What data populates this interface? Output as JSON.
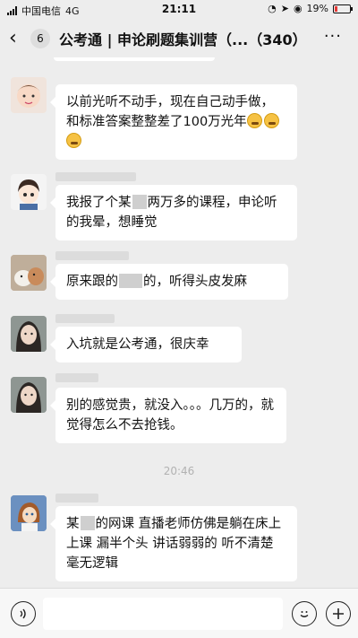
{
  "status_bar": {
    "carrier": "中国电信",
    "network": "4G",
    "time": "21:11",
    "battery_percent": "19%",
    "battery_level": 0.19
  },
  "header": {
    "back_count": "6",
    "title": "公考通 | 申论刷题集训营（...（340）",
    "more": "···"
  },
  "messages": [
    {
      "text_parts": [
        "以前光听不动手，现在自己动手做，和标准答案整整差了100万光年"
      ],
      "emoji_count": 3
    },
    {
      "text_parts": [
        "我报了个某",
        "两万多的课程，申论听的我晕，想睡觉"
      ]
    },
    {
      "text_parts": [
        "原来跟的",
        "的，听得头皮发麻"
      ]
    },
    {
      "text_parts": [
        "入坑就是公考通，很庆幸"
      ]
    },
    {
      "text_parts": [
        "别的感觉贵，就没入。。。几万的，就觉得怎么不去抢钱。"
      ]
    },
    {
      "text_parts": [
        "某",
        "的网课 直播老师仿佛是躺在床上上课 漏半个头 讲话弱弱的 听不清楚 毫无逻辑"
      ]
    }
  ],
  "timestamp": "20:46",
  "input": {
    "placeholder": ""
  }
}
